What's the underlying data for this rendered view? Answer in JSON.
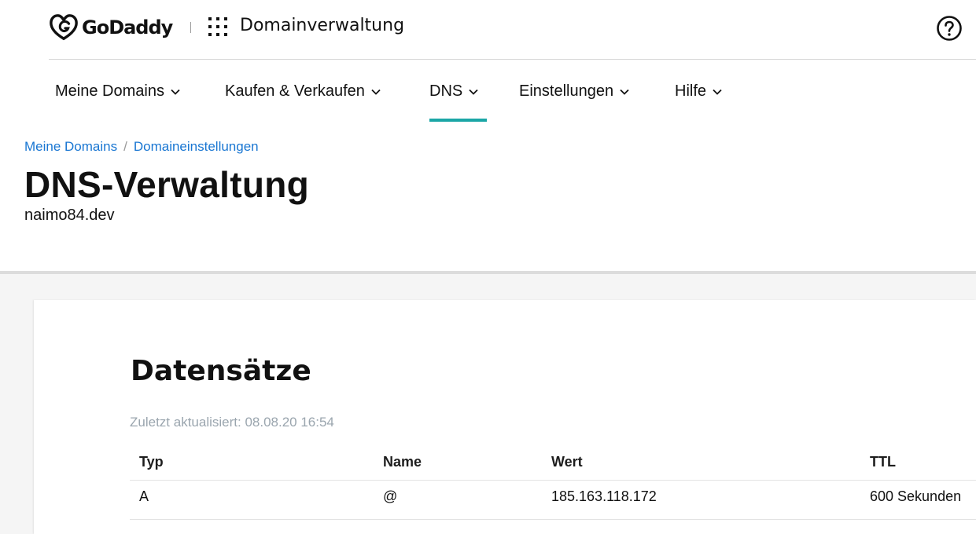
{
  "header": {
    "brand": "GoDaddy",
    "app_title": "Domainverwaltung",
    "icons": {
      "logo": "godaddy-logo-icon",
      "apps": "apps-grid-icon",
      "help": "help-circle-icon"
    }
  },
  "nav": {
    "items": [
      {
        "label": "Meine Domains"
      },
      {
        "label": "Kaufen & Verkaufen"
      },
      {
        "label": "DNS",
        "active": true
      },
      {
        "label": "Einstellungen"
      },
      {
        "label": "Hilfe"
      }
    ],
    "accent_color": "#1ba6a6"
  },
  "breadcrumb": {
    "items": [
      "Meine Domains",
      "Domaineinstellungen"
    ],
    "separator": "/"
  },
  "page": {
    "title": "DNS-Verwaltung",
    "domain": "naimo84.dev"
  },
  "records": {
    "title": "Datensätze",
    "last_updated": "Zuletzt aktualisiert: 08.08.20 16:54",
    "columns": [
      "Typ",
      "Name",
      "Wert",
      "TTL"
    ],
    "rows": [
      {
        "typ": "A",
        "name": "@",
        "wert": "185.163.118.172",
        "ttl": "600 Sekunden"
      }
    ]
  },
  "colors": {
    "link": "#1976d2",
    "muted": "#9aa5ae",
    "background": "#f5f5f5"
  }
}
